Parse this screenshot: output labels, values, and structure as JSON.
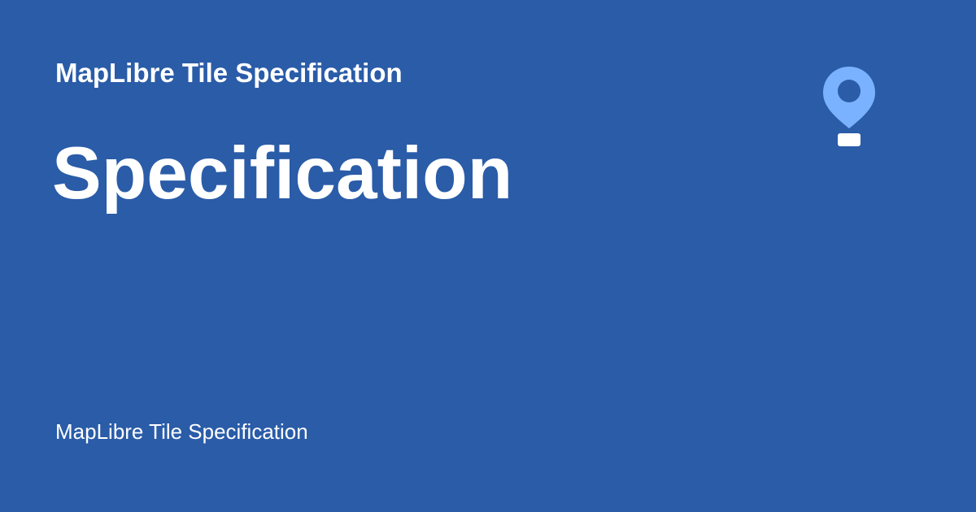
{
  "header": {
    "site_name": "MapLibre Tile Specification"
  },
  "main": {
    "title": "Specification"
  },
  "footer": {
    "text": "MapLibre Tile Specification"
  },
  "logo": {
    "icon": "map-pin-icon"
  },
  "colors": {
    "background": "#2a5ca8",
    "text": "#ffffff",
    "pin": "#7ab2ff"
  }
}
